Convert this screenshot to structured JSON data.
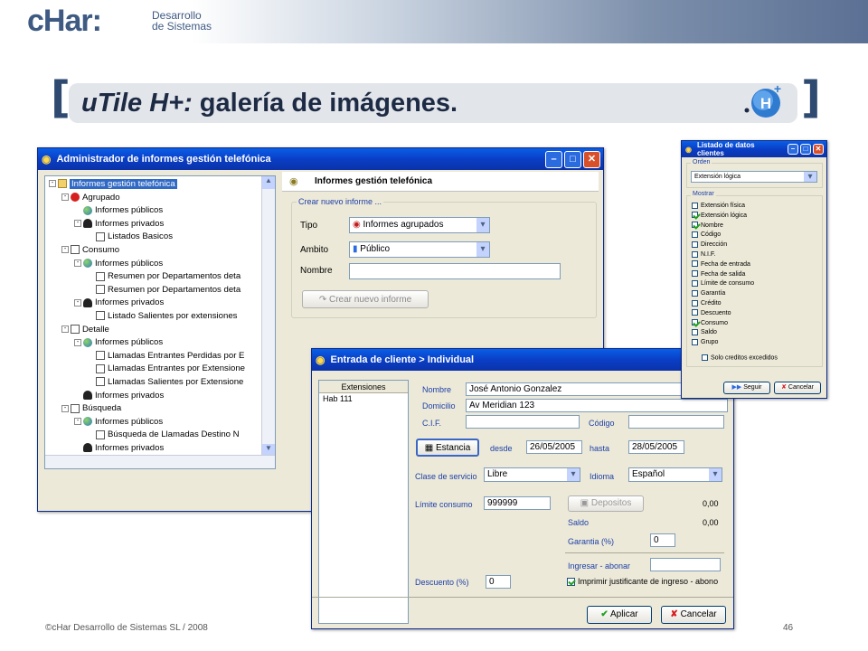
{
  "header": {
    "logo_text": "cHar:",
    "logo_sub1": "Desarrollo",
    "logo_sub2": "de Sistemas"
  },
  "slide": {
    "title_italic": "uTile H+:",
    "title_rest": " galería de imágenes.",
    "bracket_left": "[",
    "bracket_right": "]",
    "footer_left": "©cHar Desarrollo de Sistemas SL / 2008",
    "page_number": "46"
  },
  "win_admin": {
    "title": "Administrador de informes gestión telefónica",
    "tree": [
      {
        "label": "Informes gestión telefónica",
        "level": 0,
        "icon": "folder",
        "pm": "-"
      },
      {
        "label": "Agrupado",
        "level": 1,
        "icon": "red",
        "pm": "-"
      },
      {
        "label": "Informes públicos",
        "level": 2,
        "icon": "globe",
        "pm": ""
      },
      {
        "label": "Informes privados",
        "level": 2,
        "icon": "person",
        "pm": "-"
      },
      {
        "label": "Listados Basicos",
        "level": 3,
        "icon": "doc",
        "pm": ""
      },
      {
        "label": "Consumo",
        "level": 1,
        "icon": "doc",
        "pm": "-"
      },
      {
        "label": "Informes públicos",
        "level": 2,
        "icon": "globe",
        "pm": "-"
      },
      {
        "label": "Resumen por Departamentos deta",
        "level": 3,
        "icon": "doc",
        "pm": ""
      },
      {
        "label": "Resumen por Departamentos deta",
        "level": 3,
        "icon": "doc",
        "pm": ""
      },
      {
        "label": "Informes privados",
        "level": 2,
        "icon": "person",
        "pm": "-"
      },
      {
        "label": "Listado Salientes por extensiones",
        "level": 3,
        "icon": "doc",
        "pm": ""
      },
      {
        "label": "Detalle",
        "level": 1,
        "icon": "doc",
        "pm": "-"
      },
      {
        "label": "Informes públicos",
        "level": 2,
        "icon": "globe",
        "pm": "-"
      },
      {
        "label": "Llamadas Entrantes Perdidas por E",
        "level": 3,
        "icon": "doc",
        "pm": ""
      },
      {
        "label": "Llamadas Entrantes por Extensione",
        "level": 3,
        "icon": "doc",
        "pm": ""
      },
      {
        "label": "Llamadas Salientes por Extensione",
        "level": 3,
        "icon": "doc",
        "pm": ""
      },
      {
        "label": "Informes privados",
        "level": 2,
        "icon": "person",
        "pm": ""
      },
      {
        "label": "Búsqueda",
        "level": 1,
        "icon": "doc",
        "pm": "-"
      },
      {
        "label": "Informes públicos",
        "level": 2,
        "icon": "globe",
        "pm": "-"
      },
      {
        "label": "Búsqueda de Llamadas Destino N",
        "level": 3,
        "icon": "doc",
        "pm": ""
      },
      {
        "label": "Informes privados",
        "level": 2,
        "icon": "person",
        "pm": ""
      }
    ],
    "panel_title": "Informes gestión telefónica",
    "group_title": "Crear nuevo informe ...",
    "tipo_label": "Tipo",
    "tipo_value": "Informes agrupados",
    "ambito_label": "Ambito",
    "ambito_value": "Público",
    "nombre_label": "Nombre",
    "nombre_value": "",
    "create_button": "Crear nuevo informe"
  },
  "win_cliente": {
    "title": "Entrada de cliente > Individual",
    "ext_header": "Extensiones",
    "ext_item": "Hab 111",
    "nombre_label": "Nombre",
    "nombre_value": "José Antonio Gonzalez",
    "domicilio_label": "Domicilio",
    "domicilio_value": "Av Meridian 123",
    "cif_label": "C.I.F.",
    "cif_value": "",
    "codigo_label": "Código",
    "codigo_value": "",
    "estancia_button": "Estancia",
    "desde_label": "desde",
    "desde_value": "26/05/2005",
    "hasta_label": "hasta",
    "hasta_value": "28/05/2005",
    "clase_label": "Clase de servicio",
    "clase_value": "Libre",
    "idioma_label": "Idioma",
    "idioma_value": "Español",
    "limite_label": "Límite consumo",
    "limite_value": "999999",
    "depositos_button": "Depositos",
    "depositos_value": "0,00",
    "saldo_label": "Saldo",
    "saldo_value": "0,00",
    "garantia_label": "Garantia (%)",
    "garantia_value": "0",
    "ingresar_label": "Ingresar - abonar",
    "ingresar_value": "",
    "descuento_label": "Descuento (%)",
    "descuento_value": "0",
    "imprimir_label": "Imprimir justificante de ingreso - abono",
    "imprimir_checked": true,
    "aplicar_button": "Aplicar",
    "cancelar_button": "Cancelar"
  },
  "win_listado": {
    "title": "Listado de datos clientes",
    "orden_label": "Orden",
    "orden_value": "Extensión lógica",
    "mostrar_label": "Mostrar",
    "options": [
      {
        "label": "Extensión física",
        "checked": false
      },
      {
        "label": "Extensión lógica",
        "checked": true
      },
      {
        "label": "Nombre",
        "checked": true
      },
      {
        "label": "Código",
        "checked": false
      },
      {
        "label": "Dirección",
        "checked": false
      },
      {
        "label": "N.I.F.",
        "checked": false
      },
      {
        "label": "Fecha de entrada",
        "checked": false
      },
      {
        "label": "Fecha de salida",
        "checked": false
      },
      {
        "label": "Límite de consumo",
        "checked": false
      },
      {
        "label": "Garantía",
        "checked": false
      },
      {
        "label": "Crédito",
        "checked": false
      },
      {
        "label": "Descuento",
        "checked": false
      },
      {
        "label": "Consumo",
        "checked": true
      },
      {
        "label": "Saldo",
        "checked": false
      },
      {
        "label": "Grupo",
        "checked": false
      }
    ],
    "solo_label": "Solo creditos excedidos",
    "seguir_button": "Seguir",
    "cancelar_button": "Cancelar"
  }
}
